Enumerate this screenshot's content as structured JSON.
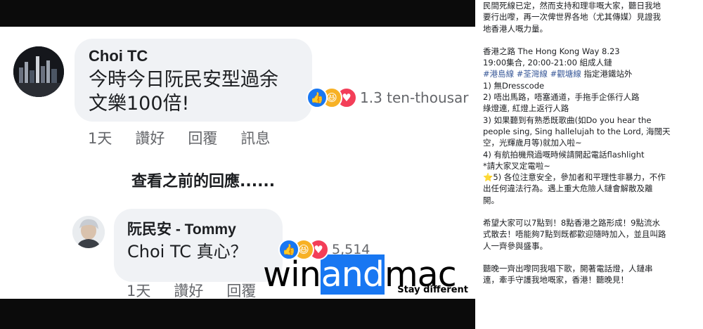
{
  "comments": [
    {
      "author": "Choi TC",
      "text_lines": [
        "今時今日阮民安型過余",
        "文樂100倍!"
      ],
      "reaction_count": "1.3 ten-thousar",
      "actions": [
        "1天",
        "讚好",
        "回覆",
        "訊息"
      ]
    },
    {
      "author": "阮民安 - Tommy",
      "text_lines": [
        "Choi TC 真心？"
      ],
      "reaction_count": "5,514",
      "actions": [
        "1天",
        "讚好",
        "回覆"
      ]
    }
  ],
  "view_previous": "查看之前的回應......",
  "reaction_icons": [
    "like-icon",
    "haha-icon",
    "love-icon"
  ],
  "colors": {
    "like": "#1877f2",
    "haha": "#f7b125",
    "love": "#f33e58",
    "watermark_accent": "#1877f2"
  },
  "watermark": {
    "win": "win",
    "and": "and",
    "mac": "mac",
    "tagline": "Stay different"
  },
  "article": {
    "intro": [
      "民間死線已定，然而支持和理非嘅大家，聽日我地",
      "要行出嚟，再一次俾世界各地（尤其傳媒）見證我",
      "地香港人嘅力量。"
    ],
    "event_title": "香港之路 The Hong Kong Way 8.23",
    "event_time": "19:00集合, 20:00-21:00 組成人鏈",
    "hashtags": [
      "#港島線",
      "#荃灣線",
      "#觀塘線"
    ],
    "hashtag_suffix": " 指定港鐵站外",
    "rules": [
      "1) 無Dresscode",
      "2) 唔出馬路，唔塞通道，手拖手企係行人路",
      "綠燈連, 紅燈上返行人路",
      "3) 如果聽到有熟悉既歌曲(如Do you hear the",
      "people sing, Sing hallelujah to the Lord, 海闊天",
      "空，光輝歲月等)就加入啦~",
      "4) 有航拍機飛過嘅時候請開起電話flashlight",
      "*請大家叉定電啦~",
      "⭐5) 各位注意安全，參加者和平理性非暴力，不作",
      "出任何違法行為。遇上重大危險人鏈會解散及離",
      "開。"
    ],
    "hope": [
      "希望大家可以7點到！8點香港之路形成！9點流水",
      "式散去！唔能夠7點到既都歡迎隨時加入，並且叫路",
      "人一齊參與盛事。"
    ],
    "closing": [
      "聽晚一齊出嚟同我唱下歌，開著電話燈，人鏈串",
      "連，牽手守護我地嘅家，香港！聽晚見！"
    ]
  }
}
